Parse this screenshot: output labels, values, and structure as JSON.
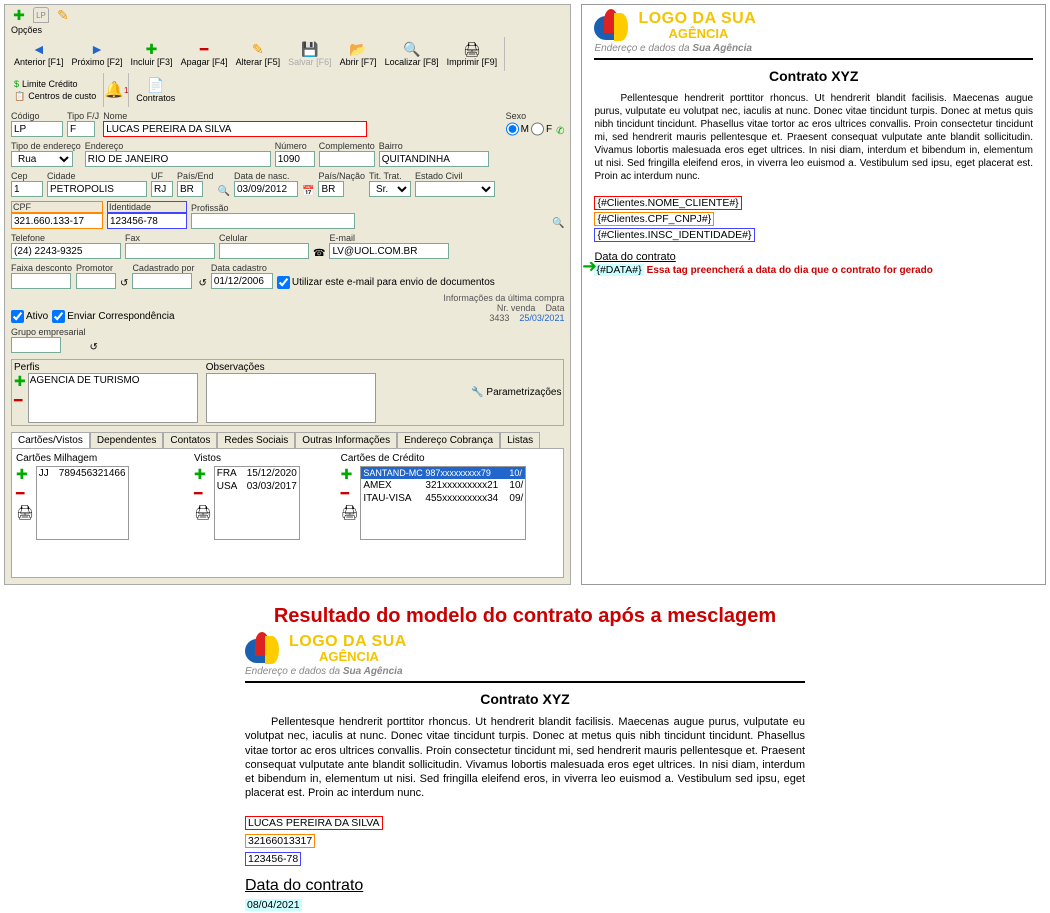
{
  "toolbar_small": {
    "opcoes": "Opções"
  },
  "toolbar": {
    "anterior": "Anterior [F1]",
    "proximo": "Próximo [F2]",
    "incluir": "Incluir [F3]",
    "apagar": "Apagar [F4]",
    "alterar": "Alterar [F5]",
    "salvar": "Salvar [F6]",
    "abrir": "Abrir [F7]",
    "localizar": "Localizar [F8]",
    "imprimir": "Imprimir [F9]",
    "limite": "Limite Crédito",
    "centros": "Centros de custo",
    "contratos": "Contratos"
  },
  "fields": {
    "codigo_label": "Código",
    "codigo": "LP",
    "tipofj_label": "Tipo F/J",
    "tipofj": "F",
    "nome_label": "Nome",
    "nome": "LUCAS PEREIRA DA SILVA",
    "sexo_label": "Sexo",
    "sexo_m": "M",
    "sexo_f": "F",
    "tipoend_label": "Tipo de endereço",
    "tipoend": "Rua",
    "endereco_label": "Endereço",
    "endereco": "RIO DE JANEIRO",
    "numero_label": "Número",
    "numero": "1090",
    "complemento_label": "Complemento",
    "complemento": "",
    "bairro_label": "Bairro",
    "bairro": "QUITANDINHA",
    "cep_label": "Cep",
    "cep": "1",
    "cidade_label": "Cidade",
    "cidade": "PETRÓPOLIS",
    "uf_label": "UF",
    "uf": "RJ",
    "paisend_label": "País/End",
    "paisend": "BR",
    "datanasc_label": "Data de nasc.",
    "datanasc": "03/09/2012",
    "paisnacao_label": "País/Nação",
    "paisnacao": "BR",
    "tittrat_label": "Tit. Trat.",
    "tittrat": "Sr.",
    "estadocivil_label": "Estado Civil",
    "estadocivil": "",
    "cpf_label": "CPF",
    "cpf": "321.660.133-17",
    "identidade_label": "Identidade",
    "identidade": "123456-78",
    "profissao_label": "Profissão",
    "profissao": "",
    "telefone_label": "Telefone",
    "telefone": "(24) 2243-9325",
    "fax_label": "Fax",
    "fax": "",
    "celular_label": "Celular",
    "celular": "",
    "email_label": "E-mail",
    "email": "LV@UOL.COM.BR",
    "faixadesc_label": "Faixa desconto",
    "faixadesc": "",
    "promotor_label": "Promotor",
    "promotor": "",
    "cadastradopor_label": "Cadastrado por",
    "cadastradopor": "",
    "datacadastro_label": "Data cadastro",
    "datacadastro": "01/12/2006",
    "utilizar_email": "Utilizar este e-mail para envio de documentos",
    "ativo": "Ativo",
    "enviar": "Enviar Correspondência",
    "grupoemp_label": "Grupo empresarial",
    "info_label": "Informações da última compra",
    "nrvenda_label": "Nr. venda",
    "nrvenda": "3433",
    "data_label": "Data",
    "ultimadata": "25/03/2021",
    "perfis_label": "Perfis",
    "perfis_item": "AGENCIA DE TURISMO",
    "obs_label": "Observações",
    "param": "Parametrizações"
  },
  "tabs": [
    "Cartões/Vistos",
    "Dependentes",
    "Contatos",
    "Redes Sociais",
    "Outras Informações",
    "Endereço Cobrança",
    "Listas"
  ],
  "subcards": {
    "milhagem_title": "Cartões Milhagem",
    "vistos_title": "Vistos",
    "credito_title": "Cartões de Crédito",
    "milhagem": [
      {
        "cc": "JJ",
        "num": "789456321466"
      }
    ],
    "vistos": [
      {
        "c": "FRA",
        "d": "15/12/2020"
      },
      {
        "c": "USA",
        "d": "03/03/2017"
      }
    ],
    "credito_hdr": [
      "SANTAND-MC",
      "987xxxxxxxxx79",
      "10/"
    ],
    "credito": [
      {
        "n": "AMEX",
        "v": "321xxxxxxxxx21",
        "d": "10/"
      },
      {
        "n": "ITAU-VISA",
        "v": "455xxxxxxxxx34",
        "d": "09/"
      }
    ]
  },
  "doc": {
    "logo_l1": "LOGO DA SUA",
    "logo_l2": "AGÊNCIA",
    "end_prefix": "Endereço e dados da ",
    "end_bold": "Sua Agência",
    "title": "Contrato XYZ",
    "para": "Pellentesque hendrerit porttitor rhoncus. Ut hendrerit blandit facilisis. Maecenas augue purus, vulputate eu volutpat nec, iaculis at nunc. Donec vitae tincidunt turpis. Donec at metus quis nibh tincidunt tincidunt. Phasellus vitae tortor ac eros ultrices convallis. Proin consectetur tincidunt mi, sed hendrerit mauris pellentesque et. Praesent consequat vulputate ante blandit sollicitudin. Vivamus lobortis malesuada eros eget ultrices.  In nisi diam, interdum et bibendum in, elementum ut nisi. Sed fringilla eleifend eros, in viverra leo euismod a. Vestibulum sed ipsu, eget placerat est. Proin ac interdum nunc.",
    "tag_nome": "{#Clientes.NOME_CLIENTE#}",
    "tag_cpf": "{#Clientes.CPF_CNPJ#}",
    "tag_id": "{#Clientes.INSC_IDENTIDADE#}",
    "datacontrato": "Data do contrato",
    "tag_data": "{#DATA#}",
    "data_note": "Essa tag preencherá a data do dia que o contrato for gerado"
  },
  "result_heading": "Resultado do modelo do contrato após a mesclagem",
  "result": {
    "nome": "LUCAS PEREIRA DA SILVA",
    "cpf": "32166013317",
    "id": "123456-78",
    "datacontrato": "Data do contrato",
    "data": "08/04/2021"
  }
}
